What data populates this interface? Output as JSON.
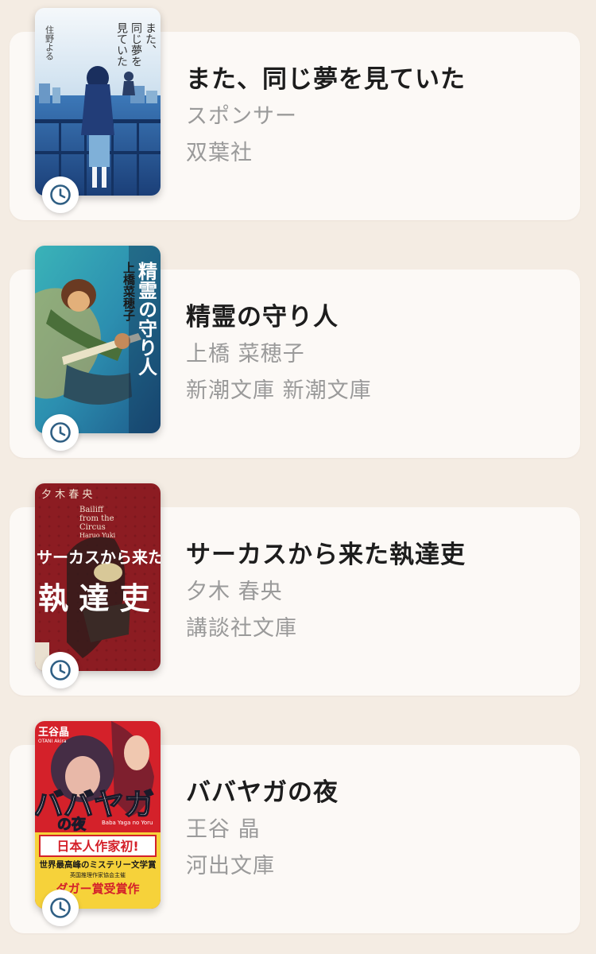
{
  "books": [
    {
      "title": "また、同じ夢を見ていた",
      "author": "スポンサー",
      "publisher": "双葉社",
      "cover": {
        "title_lines": [
          "また、",
          "同じ夢を",
          "見ていた"
        ],
        "author_text": "住野よる"
      }
    },
    {
      "title": "精霊の守り人",
      "author": "上橋 菜穂子",
      "publisher": "新潮文庫 新潮文庫",
      "cover": {
        "title_text": "精霊の守り人",
        "author_text": "上橋菜穂子"
      }
    },
    {
      "title": "サーカスから来た執達吏",
      "author": "夕木 春央",
      "publisher": "講談社文庫",
      "cover": {
        "author_text": "夕 木 春 央",
        "english_lines": [
          "Bailiff",
          "from the",
          "Circus"
        ],
        "romaji": "Haruo Yuki",
        "subtitle": "サーカスから来た",
        "kanji_text": "執 達 吏"
      }
    },
    {
      "title": "ババヤガの夜",
      "author": "王谷 晶",
      "publisher": "河出文庫",
      "cover": {
        "author_text": "王谷晶",
        "author_romaji": "OTANI Akira",
        "title_text": "ババヤガ",
        "title_no": "の夜",
        "romaji": "Baba Yaga no Yoru",
        "banner_text": "日本人作家初!",
        "line1": "世界最高峰のミステリー文学賞",
        "line2": "英国推理作家協会主催",
        "award_text": "ダガー賞受賞作"
      }
    }
  ]
}
